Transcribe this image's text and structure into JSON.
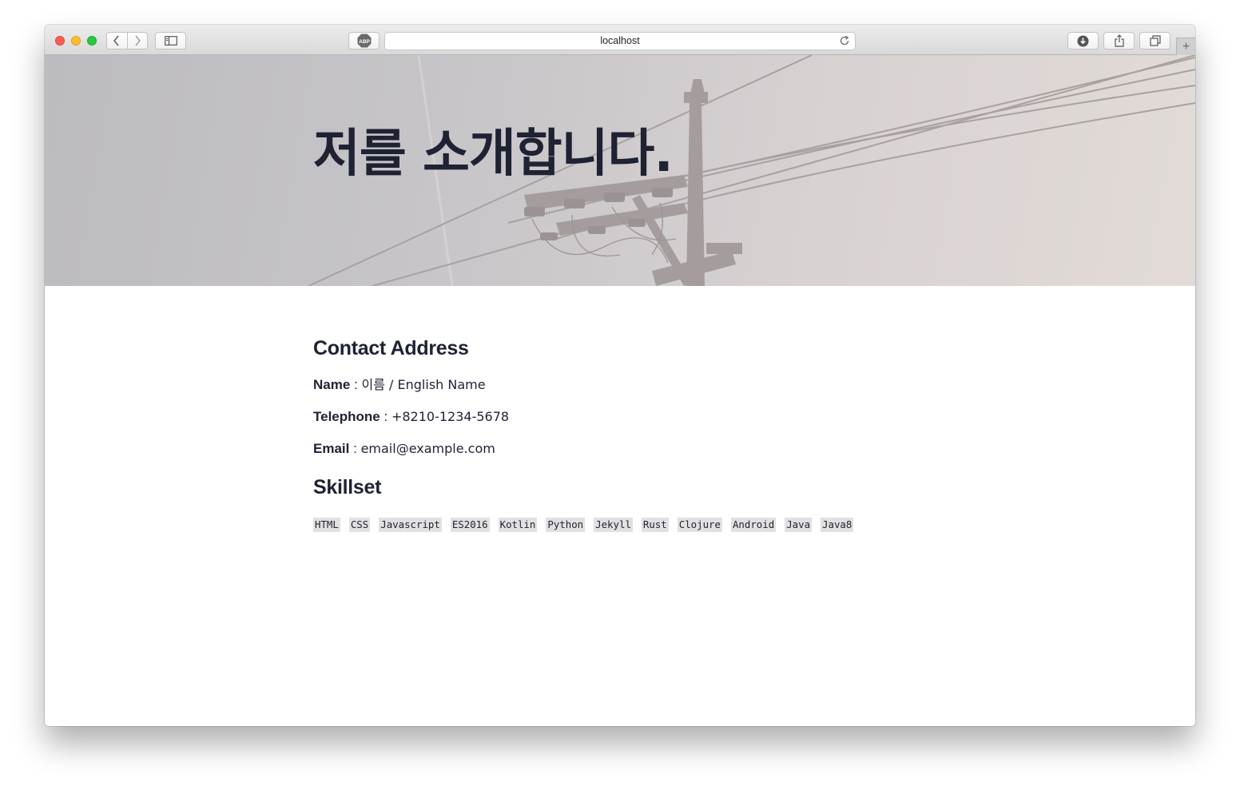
{
  "browser": {
    "address": "localhost",
    "adblock_label": "ABP",
    "new_tab_glyph": "+"
  },
  "hero": {
    "title": "저를 소개합니다."
  },
  "contact": {
    "heading": "Contact Address",
    "name_label": "Name",
    "name_value": "이름 / English Name",
    "telephone_label": "Telephone",
    "telephone_value": "+8210-1234-5678",
    "email_label": "Email",
    "email_value": "email@example.com",
    "separator": ":"
  },
  "skills": {
    "heading": "Skillset",
    "items": [
      "HTML",
      "CSS",
      "Javascript",
      "ES2016",
      "Kotlin",
      "Python",
      "Jekyll",
      "Rust",
      "Clojure",
      "Android",
      "Java",
      "Java8"
    ]
  },
  "colors": {
    "text": "#1e2233",
    "chip_bg": "#e1e1e1",
    "close": "#fc5f57",
    "minimize": "#fdbc2e",
    "maximize": "#28c840"
  },
  "icons": [
    "back-icon",
    "forward-icon",
    "sidebar-icon",
    "adblock-icon",
    "reload-icon",
    "download-icon",
    "share-icon",
    "tabs-icon",
    "new-tab-icon"
  ]
}
